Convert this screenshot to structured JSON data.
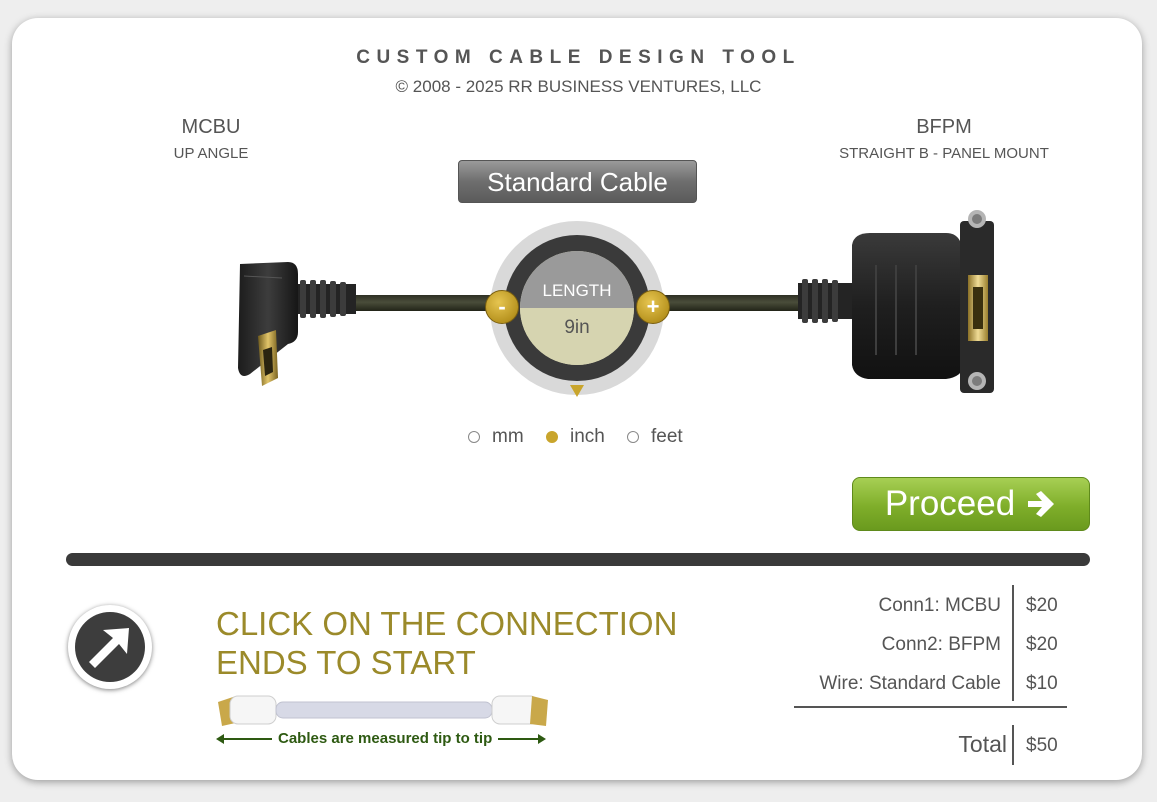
{
  "header": {
    "title": "CUSTOM CABLE DESIGN TOOL",
    "copyright": "© 2008 - 2025 RR BUSINESS VENTURES, LLC"
  },
  "connector_left": {
    "code": "MCBU",
    "description": "UP ANGLE"
  },
  "connector_right": {
    "code": "BFPM",
    "description": "STRAIGHT B - PANEL MOUNT"
  },
  "wire_button": {
    "label": "Standard Cable"
  },
  "length_dial": {
    "label": "LENGTH",
    "value": "9in",
    "minus": "-",
    "plus": "+"
  },
  "units": {
    "options": [
      "mm",
      "inch",
      "feet"
    ],
    "selected": "inch"
  },
  "proceed_button": {
    "label": "Proceed",
    "icon": "arrow-right-icon"
  },
  "instruction": {
    "line1": "CLICK ON THE CONNECTION",
    "line2": "ENDS TO START",
    "tip": "Cables are measured tip to tip"
  },
  "pricing": {
    "items": [
      {
        "label": "Conn1: MCBU",
        "price": "$20"
      },
      {
        "label": "Conn2: BFPM",
        "price": "$20"
      },
      {
        "label": "Wire: Standard Cable",
        "price": "$10"
      }
    ],
    "total_label": "Total",
    "total_value": "$50"
  },
  "colors": {
    "accent_gold": "#c9a52c",
    "proceed_green": "#7fae2a",
    "instruction_text": "#9b8a2a"
  }
}
